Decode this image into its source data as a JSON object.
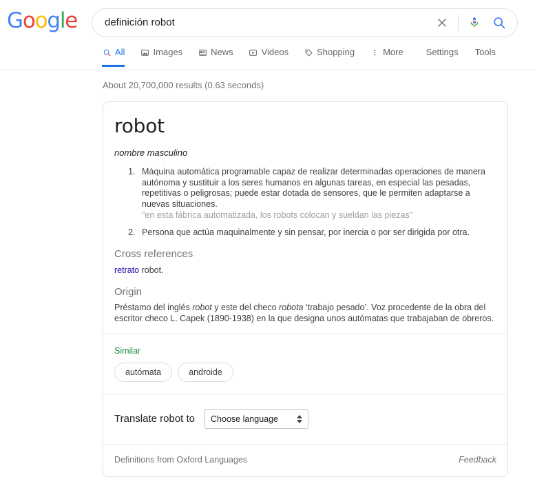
{
  "brand": {
    "logo_letters": [
      {
        "char": "G",
        "color": "#4285f4"
      },
      {
        "char": "o",
        "color": "#ea4335"
      },
      {
        "char": "o",
        "color": "#fbbc05"
      },
      {
        "char": "g",
        "color": "#4285f4"
      },
      {
        "char": "l",
        "color": "#34a853"
      },
      {
        "char": "e",
        "color": "#ea4335"
      }
    ]
  },
  "search": {
    "query": "definición robot",
    "placeholder": "Search",
    "clear_icon": "close-icon",
    "voice_icon": "microphone-icon",
    "search_icon": "magnifier-icon"
  },
  "nav": {
    "tabs": [
      {
        "label": "All",
        "icon": "magnifier-icon",
        "active": true
      },
      {
        "label": "Images",
        "icon": "image-icon",
        "active": false
      },
      {
        "label": "News",
        "icon": "newspaper-icon",
        "active": false
      },
      {
        "label": "Videos",
        "icon": "play-box-icon",
        "active": false
      },
      {
        "label": "Shopping",
        "icon": "price-tag-icon",
        "active": false
      },
      {
        "label": "More",
        "icon": "more-vertical-icon",
        "active": false
      }
    ],
    "tools": [
      {
        "label": "Settings"
      },
      {
        "label": "Tools"
      }
    ]
  },
  "results": {
    "stats": "About 20,700,000 results (0.63 seconds)"
  },
  "knowledge_panel": {
    "word": "robot",
    "part_of_speech": "nombre masculino",
    "definitions": [
      {
        "text": "Máquina automática programable capaz de realizar determinadas operaciones de manera autónoma y sustituir a los seres humanos en algunas tareas, en especial las pesadas, repetitivas o peligrosas; puede estar dotada de sensores, que le permiten adaptarse a nuevas situaciones.",
        "example": "\"en esta fábrica automatizada, los robots colocan y sueldan las piezas\""
      },
      {
        "text": "Persona que actúa maquinalmente y sin pensar, por inercia o por ser dirigida por otra.",
        "example": ""
      }
    ],
    "cross_references": {
      "title": "Cross references",
      "link_text": "retrato",
      "trailing_text": " robot."
    },
    "origin": {
      "title": "Origin",
      "part1": "Préstamo del inglés ",
      "italic1": "robot",
      "part2": " y este del checo ",
      "italic2": "robota",
      "part3": " ‘trabajo pesado’. Voz procedente de la obra del escritor checo L. Capek (1890-1938) en la que designa unos autómatas que trabajaban de obreros."
    },
    "similar": {
      "title": "Similar",
      "chips": [
        "autómata",
        "androide"
      ]
    },
    "translate": {
      "label": "Translate robot to",
      "select_value": "Choose language"
    },
    "footer": {
      "source": "Definitions from Oxford Languages",
      "feedback": "Feedback"
    }
  },
  "colors": {
    "google_blue": "#4285f4",
    "link_blue": "#1a0dab",
    "active_tab": "#1a73e8",
    "green": "#1e8e3e",
    "muted": "#70757a"
  }
}
